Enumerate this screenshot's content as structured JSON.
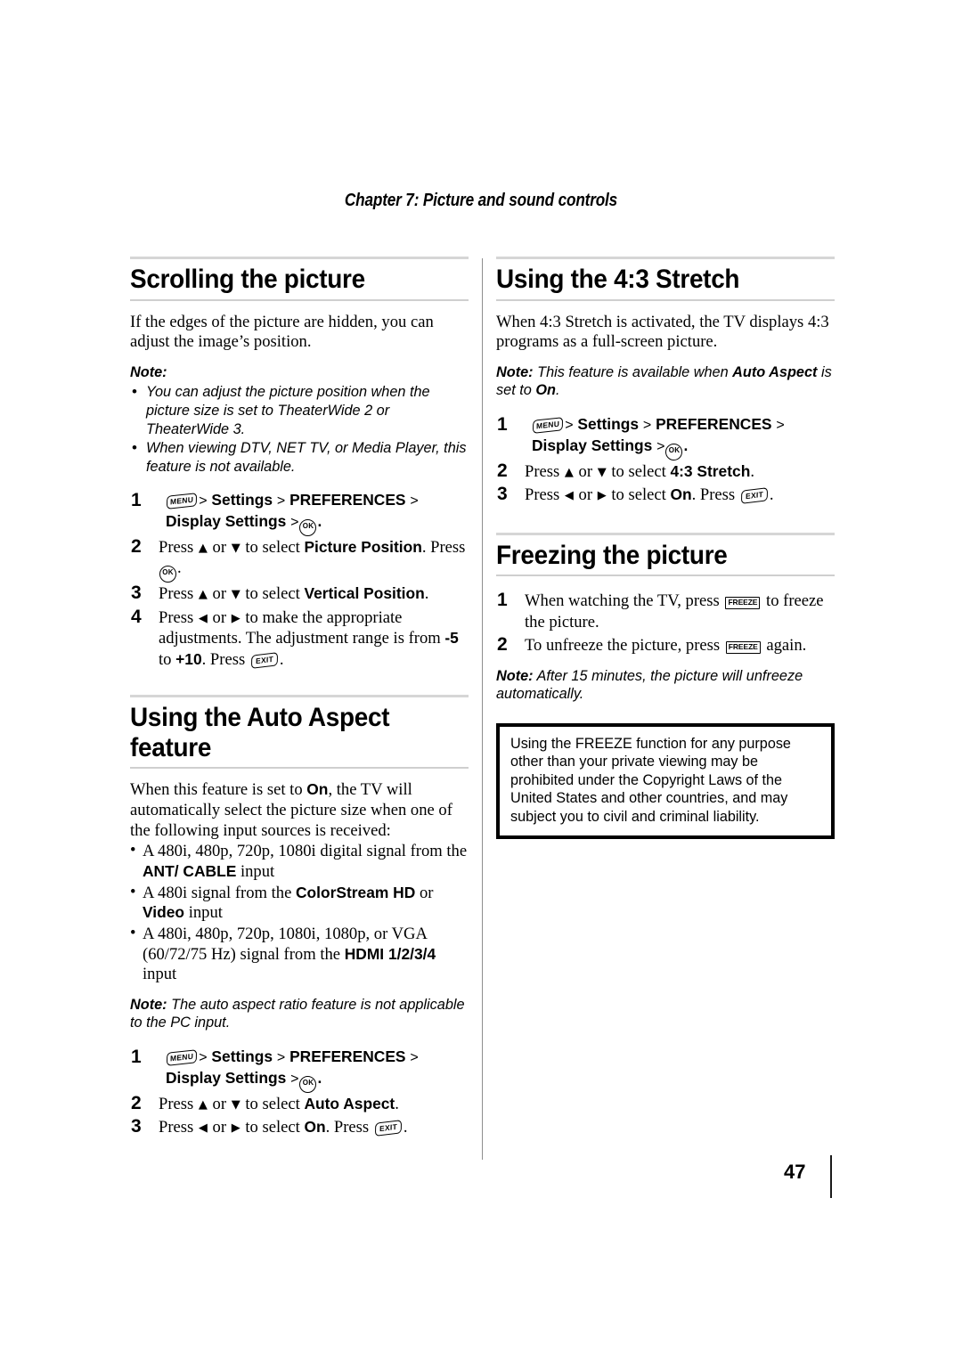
{
  "header": {
    "chapter_title": "Chapter 7: Picture and sound controls"
  },
  "icons": {
    "menu": "MENU",
    "ok": "OK",
    "exit": "EXIT",
    "freeze": "FREEZE",
    "up_arrow": "▲",
    "down_arrow": "▼",
    "left_arrow": "◀",
    "right_arrow": "▶",
    "gt": ">"
  },
  "left_column": {
    "scrolling": {
      "heading": "Scrolling the picture",
      "intro": "If the edges of the picture are hidden, you can adjust the image’s position.",
      "note_label": "Note:",
      "note_bullets": [
        {
          "pre": "You can adjust the picture position when the picture size is set to ",
          "bold1": "TheaterWide 2",
          "mid": " or ",
          "bold2": "TheaterWide 3",
          "post": "."
        },
        {
          "pre": "When viewing DTV, NET TV, or Media Player, this feature is not available.",
          "bold1": "",
          "mid": "",
          "bold2": "",
          "post": ""
        }
      ],
      "steps": {
        "step1_path": "Settings",
        "step1_path2": "PREFERENCES",
        "step1_path3": "Display Settings",
        "step2_pre": "Press ",
        "step2_mid": " or ",
        "step2_sel": " to select ",
        "step2_target": "Picture Position",
        "step2_post": ". Press ",
        "step3_target": "Vertical Position",
        "step4_text": "Press ◀ or ▶ to make the appropriate adjustments. The adjustment range is from ",
        "step4_min": "-5",
        "step4_to": " to ",
        "step4_max": "+10",
        "step4_press": ". Press "
      }
    },
    "auto_aspect": {
      "heading": "Using the Auto Aspect feature",
      "intro_pre": "When this feature is set to ",
      "intro_bold": "On",
      "intro_post": ", the TV will automatically select the picture size when one of the following input sources is received:",
      "sources": [
        {
          "pre": "A 480i, 480p, 720p, 1080i digital signal from the ",
          "bold": "ANT/ CABLE",
          "post": " input"
        },
        {
          "pre": "A 480i signal from the ",
          "bold": "ColorStream HD",
          "mid": " or ",
          "bold2": "Video",
          "post": " input"
        },
        {
          "pre": "A 480i, 480p, 720p, 1080i, 1080p, or VGA (60/72/75 Hz) signal from the ",
          "bold": "HDMI 1/2/3/4",
          "post": " input"
        }
      ],
      "note_label": "Note:",
      "note_text": " The auto aspect ratio feature is not applicable to the PC input.",
      "steps": {
        "step2_target": "Auto Aspect",
        "step3_target": "On"
      }
    }
  },
  "right_column": {
    "stretch": {
      "heading": "Using the 4:3 Stretch",
      "intro": "When 4:3 Stretch is activated, the TV displays 4:3 programs as a full-screen picture.",
      "note_label": "Note:",
      "note_pre": " This feature is available when ",
      "note_bold": "Auto Aspect",
      "note_mid": " is set to ",
      "note_bold2": "On",
      "note_post": ".",
      "steps": {
        "step2_target": "4:3 Stretch",
        "step3_target": "On"
      }
    },
    "freezing": {
      "heading": "Freezing the picture",
      "step1_pre": "When watching the TV, press ",
      "step1_post": " to freeze the picture.",
      "step2_pre": "To unfreeze the picture, press ",
      "step2_post": " again.",
      "note_label": "Note:",
      "note_text": " After 15 minutes, the picture will unfreeze automatically.",
      "warning": "Using the FREEZE function for any purpose other than your private viewing may be prohibited under the Copyright Laws of the United States and other countries, and may subject you to civil and criminal liability."
    }
  },
  "footer": {
    "page_number": "47"
  },
  "common": {
    "press": "Press ",
    "or": " or ",
    "to_select": " to select ",
    "period": ".",
    "press_cap": ". Press "
  }
}
